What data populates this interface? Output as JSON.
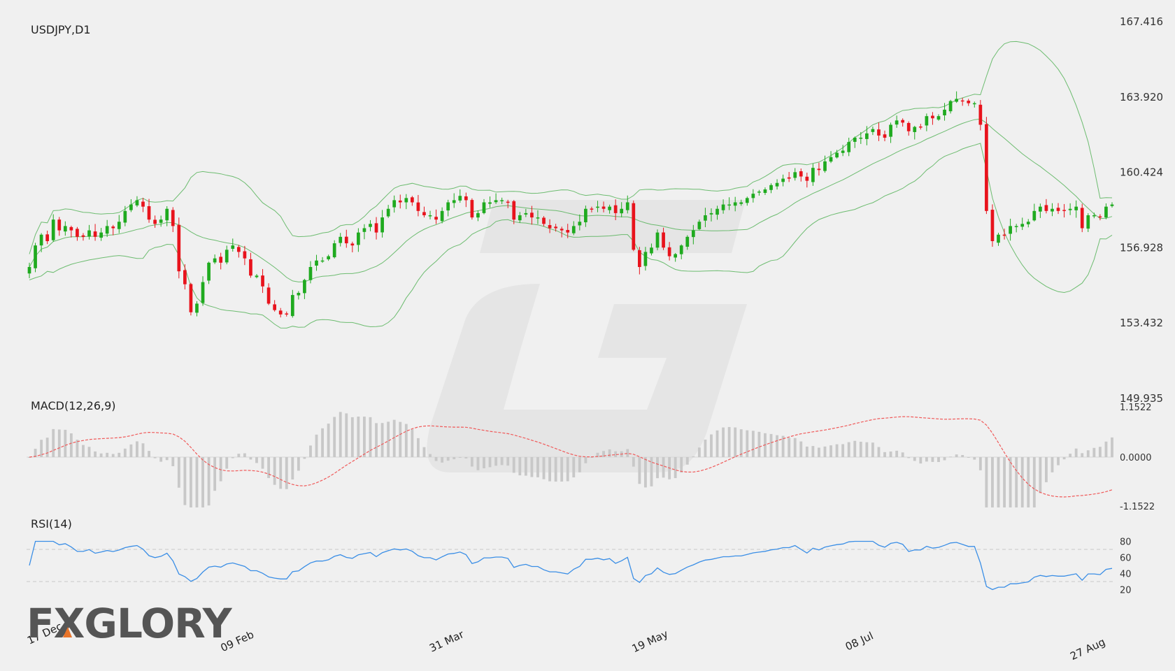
{
  "chart_data": {
    "type": "candlestick",
    "symbol_label": "USDJPY,D1",
    "price_axis": {
      "min": 149.935,
      "max": 167.416,
      "ticks": [
        "167.416",
        "163.920",
        "160.424",
        "156.928",
        "153.432",
        "149.935"
      ]
    },
    "date_labels": [
      "17 Dec",
      "09 Feb",
      "31 Mar",
      "19 May",
      "08 Jul",
      "27 Aug"
    ],
    "candles": {
      "count": 181,
      "closes": [
        156.0,
        157.0,
        157.5,
        157.2,
        158.2,
        157.7,
        157.9,
        157.7,
        157.4,
        157.4,
        157.7,
        157.4,
        157.6,
        157.9,
        157.8,
        158.1,
        158.6,
        158.9,
        159.1,
        158.8,
        158.2,
        158.0,
        158.2,
        158.7,
        157.9,
        155.8,
        155.2,
        153.9,
        154.3,
        155.3,
        156.2,
        156.4,
        156.2,
        156.8,
        157.0,
        156.7,
        156.4,
        155.6,
        155.6,
        155.1,
        154.3,
        154.0,
        153.8,
        153.8,
        154.7,
        154.8,
        155.4,
        156.0,
        156.3,
        156.3,
        156.5,
        157.1,
        157.4,
        157.1,
        157.0,
        157.6,
        157.8,
        158.0,
        157.6,
        158.3,
        158.7,
        159.1,
        159.0,
        159.2,
        159.0,
        158.6,
        158.4,
        158.4,
        158.2,
        158.6,
        159.0,
        159.1,
        159.3,
        159.1,
        158.3,
        158.5,
        159.0,
        159.0,
        159.1,
        159.1,
        159.0,
        158.2,
        158.4,
        158.5,
        158.3,
        158.3,
        158.0,
        157.8,
        157.8,
        157.7,
        157.6,
        157.9,
        158.1,
        158.7,
        158.7,
        158.8,
        158.7,
        158.8,
        158.5,
        158.7,
        159.0,
        156.8,
        156.0,
        156.7,
        156.9,
        157.6,
        156.9,
        156.5,
        156.6,
        157.0,
        157.4,
        157.7,
        158.1,
        158.4,
        158.5,
        158.7,
        158.9,
        158.9,
        159.0,
        159.0,
        159.2,
        159.4,
        159.5,
        159.6,
        159.8,
        159.9,
        160.1,
        160.1,
        160.4,
        160.2,
        160.0,
        160.6,
        160.5,
        160.9,
        161.1,
        161.3,
        161.4,
        161.8,
        162.0,
        162.0,
        162.2,
        162.4,
        162.1,
        162.0,
        162.6,
        162.8,
        162.7,
        162.3,
        162.5,
        162.5,
        163.0,
        162.9,
        163.0,
        163.3,
        163.7,
        163.8,
        163.7,
        163.6,
        163.6,
        162.6,
        158.6,
        157.2,
        157.5,
        157.5,
        157.9,
        157.9,
        158.0,
        158.1,
        158.6,
        158.8,
        158.6,
        158.7,
        158.6,
        158.6,
        158.7,
        158.8,
        157.8,
        158.4,
        158.4,
        158.3,
        158.8,
        158.9
      ]
    },
    "indicators": {
      "bollinger_bands": {
        "shown": true
      },
      "macd": {
        "label": "MACD(12,26,9)",
        "ticks": [
          "1.1522",
          "0.0000",
          "-1.1522"
        ],
        "ylim": [
          -1.1522,
          1.1522
        ]
      },
      "rsi": {
        "label": "RSI(14)",
        "ticks": [
          "80",
          "60",
          "40",
          "20"
        ],
        "ylim": [
          20,
          80
        ],
        "levels": [
          70,
          30
        ]
      }
    },
    "colors": {
      "up": "#1faa1f",
      "down": "#e8131c",
      "bands": "#4caf50",
      "macd_signal": "#f05a5a",
      "macd_hist": "#c8c8c8",
      "rsi_line": "#3a8ee6",
      "grid": "#cccccc"
    },
    "grid": false
  },
  "branding": {
    "logo_text": "FXGLORY",
    "accent_color": "#e8742a"
  }
}
